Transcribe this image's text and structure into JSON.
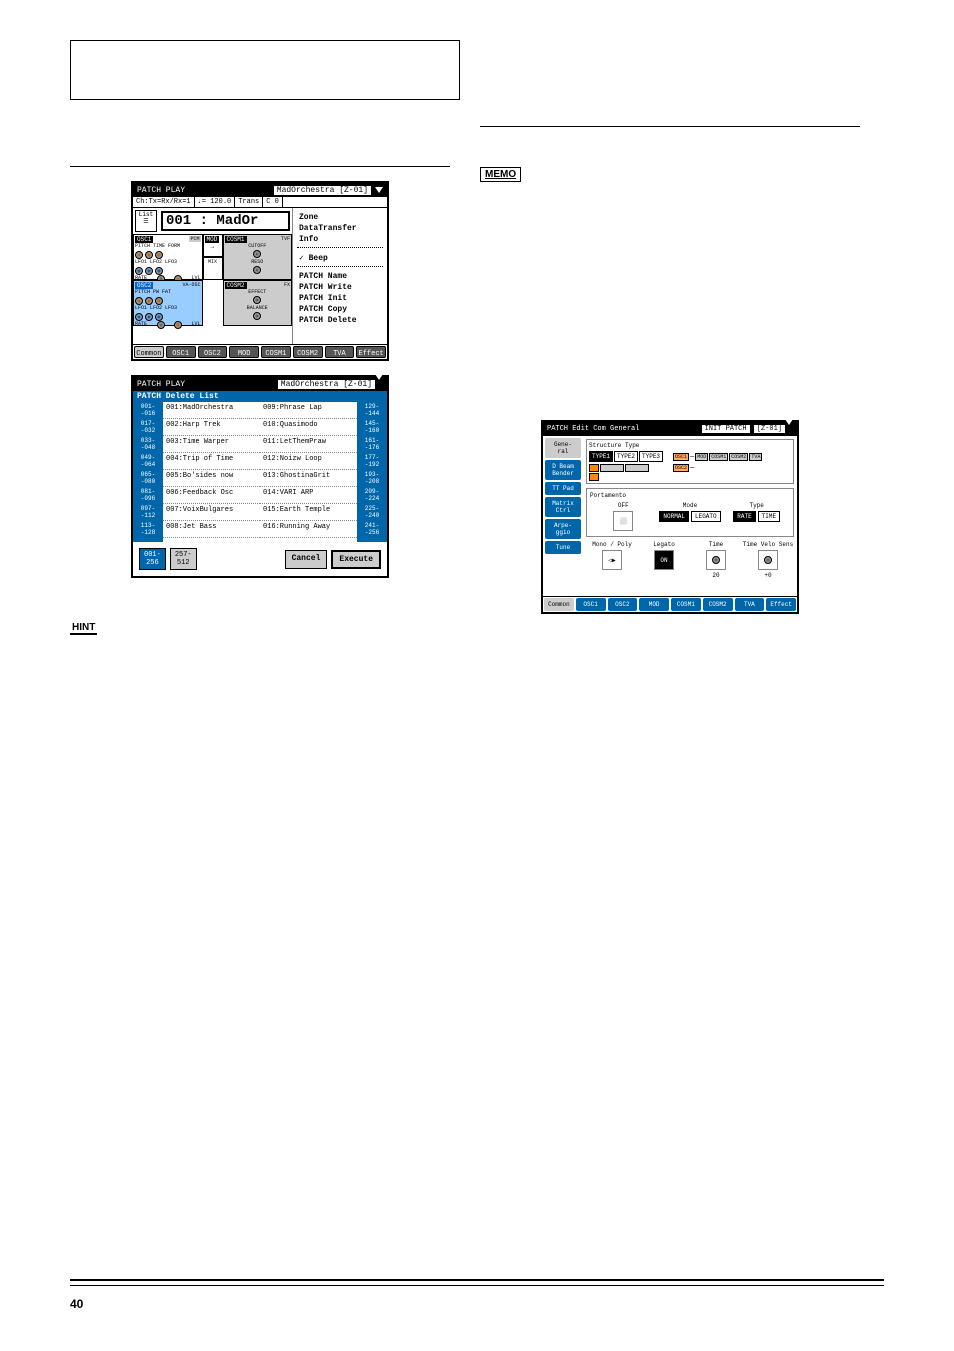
{
  "page_number": "40",
  "badge_memo": "MEMO",
  "badge_hint": "HINT",
  "screenshotA": {
    "title_left": "PATCH PLAY",
    "title_right": "MadOrchestra [Z-01]",
    "infobar": {
      "ch": "Ch:Tx=Rx/Rx=1",
      "tempo": "♩= 120.0",
      "trans_label": "Trans",
      "trans_val": "C 0"
    },
    "list_label": "List",
    "patch_number": "001 : MadOr",
    "osc1": {
      "label": "OSC1",
      "type": "PCM",
      "row1": "PITCH TIME FORM",
      "row2": "LFO1 LFO2 LFO3",
      "row3": "RATE",
      "lvl": "LVL"
    },
    "osc2": {
      "label": "OSC2",
      "type": "VA-OSC",
      "row1": "PITCH PW FAT",
      "row2": "LFO1 LFO2 LFO3",
      "row3": "RATE",
      "lvl": "LVL"
    },
    "mod": {
      "label": "MOD",
      "mix": "MIX"
    },
    "cosm1": {
      "label": "COSM1",
      "type": "TVF",
      "p1": "CUTOFF",
      "p2": "RESO"
    },
    "cosm2": {
      "label": "COSM2",
      "type": "FX",
      "p1": "EFFECT",
      "p2": "BALANCE"
    },
    "menu": {
      "zone": "Zone",
      "dt": "DataTransfer",
      "info": "Info",
      "beep": "Beep",
      "name": "PATCH Name",
      "write": "PATCH Write",
      "init": "PATCH Init",
      "copy": "PATCH Copy",
      "delete": "PATCH Delete"
    },
    "tabs": [
      "Common",
      "OSC1",
      "OSC2",
      "MOD",
      "COSM1",
      "COSM2",
      "TVA",
      "Effect"
    ]
  },
  "screenshotB": {
    "title_left": "PATCH PLAY",
    "title_right": "MadOrchestra [Z-01]",
    "subheader": "PATCH Delete List",
    "left_ranges": [
      "001-\n-016",
      "017-\n-032",
      "033-\n-048",
      "049-\n-064",
      "065-\n-080",
      "081-\n-096",
      "097-\n-112",
      "113-\n-128"
    ],
    "col1": [
      "001:MadOrchestra",
      "002:Harp Trek",
      "003:Time Warper",
      "004:Trip of Time",
      "005:Bo'sides now",
      "006:Feedback Osc",
      "007:VoixBulgares",
      "008:Jet Bass"
    ],
    "col2": [
      "009:Phrase Lap",
      "010:Quasimodo",
      "011:LetThemPraw",
      "012:Noizw Loop",
      "013:GhostinaGrit",
      "014:VARI ARP",
      "015:Earth Temple",
      "016:Running Away"
    ],
    "right_ranges": [
      "129-\n-144",
      "145-\n-160",
      "161-\n-176",
      "177-\n-192",
      "193-\n-208",
      "209-\n-224",
      "225-\n-240",
      "241-\n-256"
    ],
    "bottom_ranges": [
      "001-\n256",
      "257-\n512"
    ],
    "cancel": "Cancel",
    "execute": "Execute"
  },
  "screenshotC": {
    "title_left": "PATCH Edit Com General",
    "title_mid": "INIT PATCH",
    "title_right": "[Z-01]",
    "side": [
      "Gene-\nral",
      "D Beam\nBender",
      "TT Pad",
      "Matrix\nCtrl",
      "Arpe-\nggio",
      "Tune"
    ],
    "struct_label": "Structure Type",
    "struct_types": [
      "TYPE1",
      "TYPE2",
      "TYPE3"
    ],
    "chain1": [
      "OSC1",
      "MOD",
      "COSM1",
      "COSM2",
      "TVA"
    ],
    "chain2": [
      "OSC2"
    ],
    "port_label": "Portamento",
    "port_off": "OFF",
    "port_mode_label": "Mode",
    "port_mode_opts": [
      "NORMAL",
      "LEGATO"
    ],
    "port_type_label": "Type",
    "port_type_opts": [
      "RATE",
      "TIME"
    ],
    "lower": {
      "mp": "Mono / Poly",
      "legato": "Legato",
      "legato_on": "ON",
      "time": "Time",
      "time_val": "20",
      "tvs": "Time Velo Sens",
      "tvs_val": "+0"
    },
    "tabs": [
      "Common",
      "OSC1",
      "OSC2",
      "MOD",
      "COSM1",
      "COSM2",
      "TVA",
      "Effect"
    ]
  }
}
